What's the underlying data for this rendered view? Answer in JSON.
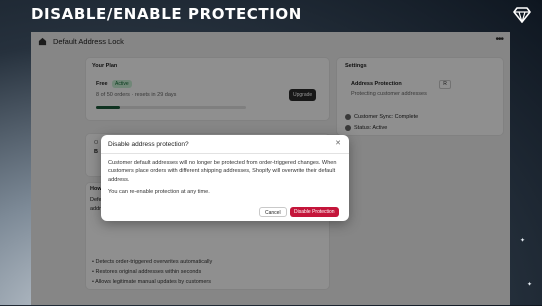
{
  "hero": {
    "title": "DISABLE/ENABLE PROTECTION"
  },
  "app": {
    "title": "Default Address Lock"
  },
  "plan": {
    "heading": "Your Plan",
    "name": "Free",
    "badge": "Active",
    "usage": "8 of 50 orders · resets in 29 days",
    "progress": 0.16,
    "upgrade": "Upgrade"
  },
  "mid_card": {
    "frag1": "O",
    "frag2": "B"
  },
  "how": {
    "heading": "How",
    "frag1": "Defe",
    "frag2": "addr",
    "bullets": [
      "Detects order-triggered overwrites automatically",
      "Restores original addresses within seconds",
      "Allows legitimate manual updates by customers"
    ]
  },
  "settings": {
    "heading": "Settings",
    "protection_label": "Address Protection",
    "protection_status": "Protecting customer addresses",
    "toggle": "R",
    "sync_label": "Customer Sync:",
    "sync_value": "Complete",
    "status_label": "Status:",
    "status_value": "Active"
  },
  "modal": {
    "title": "Disable address protection?",
    "body1": "Customer default addresses will no longer be protected from order-triggered changes. When customers place orders with different shipping addresses, Shopify will overwrite their default address.",
    "body2": "You can re-enable protection at any time.",
    "cancel": "Cancel",
    "confirm": "Disable Protection"
  },
  "colors": {
    "danger": "#c4153a",
    "progress": "#1e5b3c",
    "badge_bg": "#c9f0d6"
  }
}
